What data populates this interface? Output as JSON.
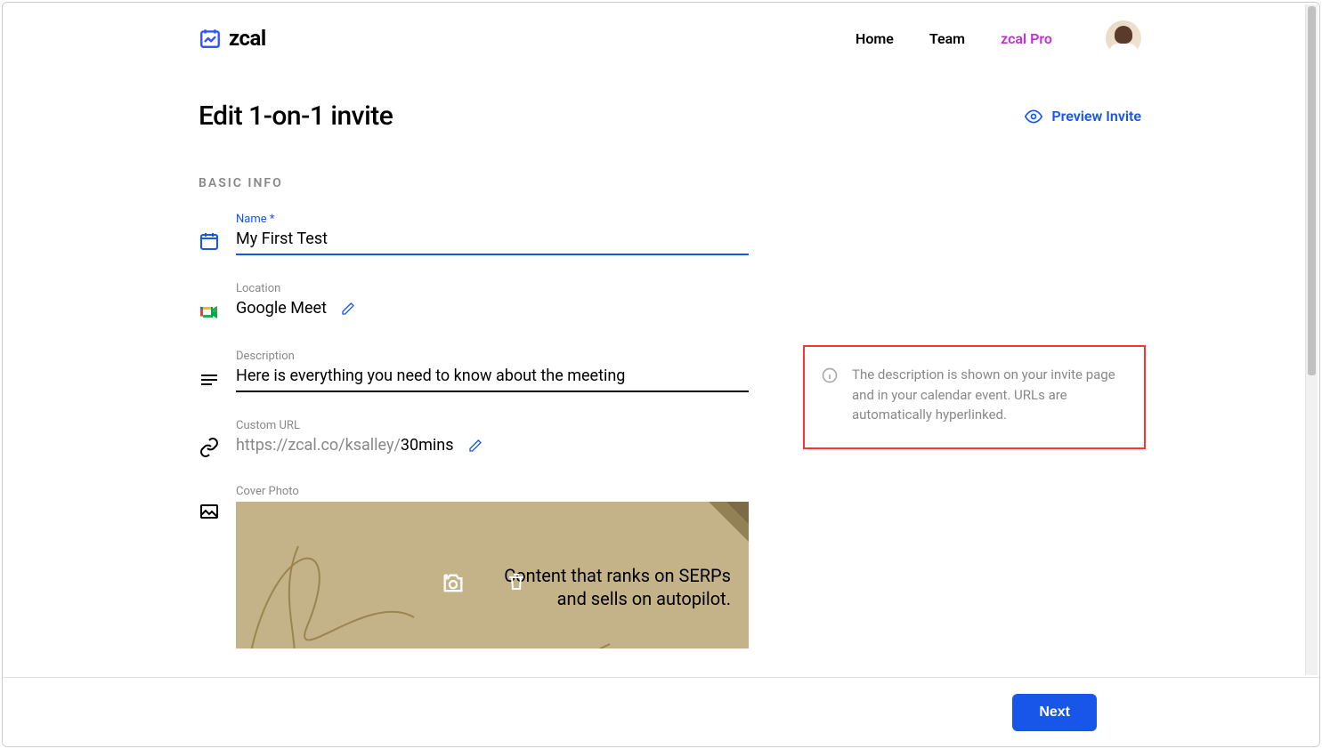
{
  "brand": {
    "name": "zcal"
  },
  "nav": {
    "home": "Home",
    "team": "Team",
    "pro": "zcal Pro"
  },
  "page": {
    "title": "Edit 1-on-1 invite",
    "preview_label": "Preview Invite"
  },
  "section": {
    "basic_info": "BASIC INFO"
  },
  "fields": {
    "name": {
      "label": "Name *",
      "value": "My First Test"
    },
    "location": {
      "label": "Location",
      "value": "Google Meet"
    },
    "description": {
      "label": "Description",
      "value": "Here is everything you need to know about the meeting"
    },
    "custom_url": {
      "label": "Custom URL",
      "prefix": "https://zcal.co/ksalley/",
      "slug": "30mins"
    },
    "cover_photo": {
      "label": "Cover Photo",
      "tagline_line1": "Content that ranks on SERPs",
      "tagline_line2": "and sells on autopilot."
    }
  },
  "info_callout": "The description is shown on your invite page and in your calendar event. URLs are automatically hyperlinked.",
  "footer": {
    "next": "Next"
  }
}
